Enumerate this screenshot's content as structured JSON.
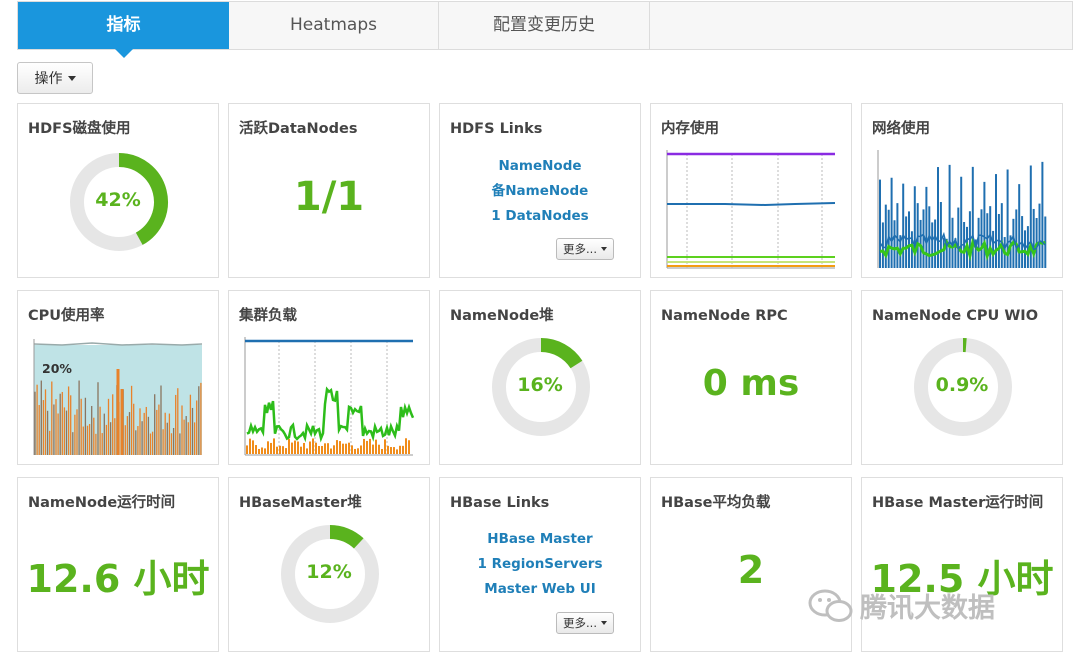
{
  "tabs": [
    {
      "label": "指标",
      "active": true
    },
    {
      "label": "Heatmaps",
      "active": false
    },
    {
      "label": "配置变更历史",
      "active": false
    }
  ],
  "actions_label": "操作",
  "more_label": "更多...",
  "colors": {
    "accent": "#1a96dd",
    "value_green": "#5ab31e",
    "link_blue": "#1f7fb8"
  },
  "widgets": {
    "hdfs_disk": {
      "title": "HDFS磁盘使用",
      "value": "42%",
      "fraction": 0.42
    },
    "live_datanodes": {
      "title": "活跃DataNodes",
      "value": "1/1"
    },
    "hdfs_links": {
      "title": "HDFS Links",
      "links": [
        "NameNode",
        "备NameNode",
        "1 DataNodes"
      ]
    },
    "memory": {
      "title": "内存使用"
    },
    "network": {
      "title": "网络使用"
    },
    "cpu": {
      "title": "CPU使用率",
      "label": "20%"
    },
    "cluster_load": {
      "title": "集群负载"
    },
    "namenode_heap": {
      "title": "NameNode堆",
      "value": "16%",
      "fraction": 0.16
    },
    "namenode_rpc": {
      "title": "NameNode RPC",
      "value": "0 ms"
    },
    "namenode_cpu_wio": {
      "title": "NameNode CPU WIO",
      "value": "0.9%",
      "fraction": 0.009
    },
    "namenode_uptime": {
      "title": "NameNode运行时间",
      "value": "12.6 小时"
    },
    "hbasemaster_heap": {
      "title": "HBaseMaster堆",
      "value": "12%",
      "fraction": 0.12
    },
    "hbase_links": {
      "title": "HBase Links",
      "links": [
        "HBase Master",
        "1 RegionServers",
        "Master Web UI"
      ]
    },
    "hbase_avg_load": {
      "title": "HBase平均负载",
      "value": "2"
    },
    "hbase_master_uptime": {
      "title": "HBase Master运行时间",
      "value": "12.5 小时"
    }
  },
  "watermark": "腾讯大数据"
}
